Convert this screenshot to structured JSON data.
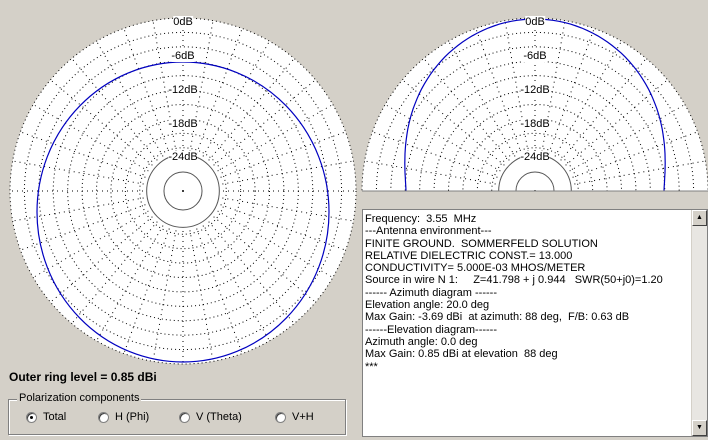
{
  "left_plot": {
    "ring_labels": [
      "0dB",
      "-6dB",
      "-12dB",
      "-18dB",
      "-24dB"
    ],
    "curve_color": "#0000c0"
  },
  "right_plot": {
    "ring_labels": [
      "0dB",
      "-6dB",
      "-12dB",
      "-18dB",
      "-24dB"
    ],
    "curve_color": "#0000c0"
  },
  "outer_ring_text": "Outer ring level = 0.85 dBi",
  "polarization": {
    "title": "Polarization components",
    "options": [
      {
        "label": "Total",
        "selected": true
      },
      {
        "label": "H (Phi)",
        "selected": false
      },
      {
        "label": "V (Theta)",
        "selected": false
      },
      {
        "label": "V+H",
        "selected": false
      }
    ]
  },
  "report_lines": [
    "Frequency:  3.55  MHz",
    "---Antenna environment---",
    "FINITE GROUND.  SOMMERFELD SOLUTION",
    "RELATIVE DIELECTRIC CONST.= 13.000",
    "CONDUCTIVITY= 5.000E-03 MHOS/METER",
    "Source in wire N 1:     Z=41.798 + j 0.944   SWR(50+j0)=1.20",
    "------ Azimuth diagram ------",
    "Elevation angle: 20.0 deg",
    "Max Gain: -3.69 dBi  at azimuth: 88 deg,  F/B: 0.63 dB",
    "------Elevation diagram------",
    "Azimuth angle: 0.0 deg",
    "Max Gain: 0.85 dBi at elevation  88 deg",
    "***"
  ],
  "icons": {
    "scroll_up": "scroll-up-arrow-icon",
    "scroll_down": "scroll-down-arrow-icon"
  }
}
